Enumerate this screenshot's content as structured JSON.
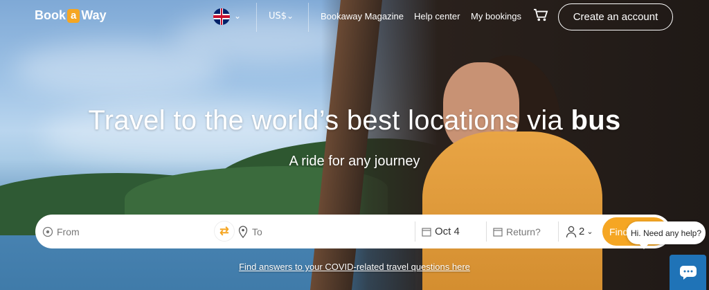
{
  "header": {
    "logo": {
      "part1": "Book",
      "part2": "a",
      "part3": "Way"
    },
    "language_icon": "uk-flag-icon",
    "currency": "US$",
    "nav": [
      "Bookaway Magazine",
      "Help center",
      "My bookings"
    ],
    "cart_icon": "cart-icon",
    "create_account": "Create an account"
  },
  "hero": {
    "title_main": "Travel to the world’s best locations via",
    "title_bold": "bus",
    "subtitle": "A ride for any journey"
  },
  "search": {
    "from_placeholder": "From",
    "to_placeholder": "To",
    "depart_date": "Oct 4",
    "return_placeholder": "Return?",
    "passengers": "2",
    "find_label": "Find"
  },
  "covid_link": "Find answers to your COVID-related travel questions here",
  "chat": {
    "bubble": "Hi. Need any help?"
  },
  "colors": {
    "accent": "#f5a623",
    "chat": "#1f73b7"
  }
}
